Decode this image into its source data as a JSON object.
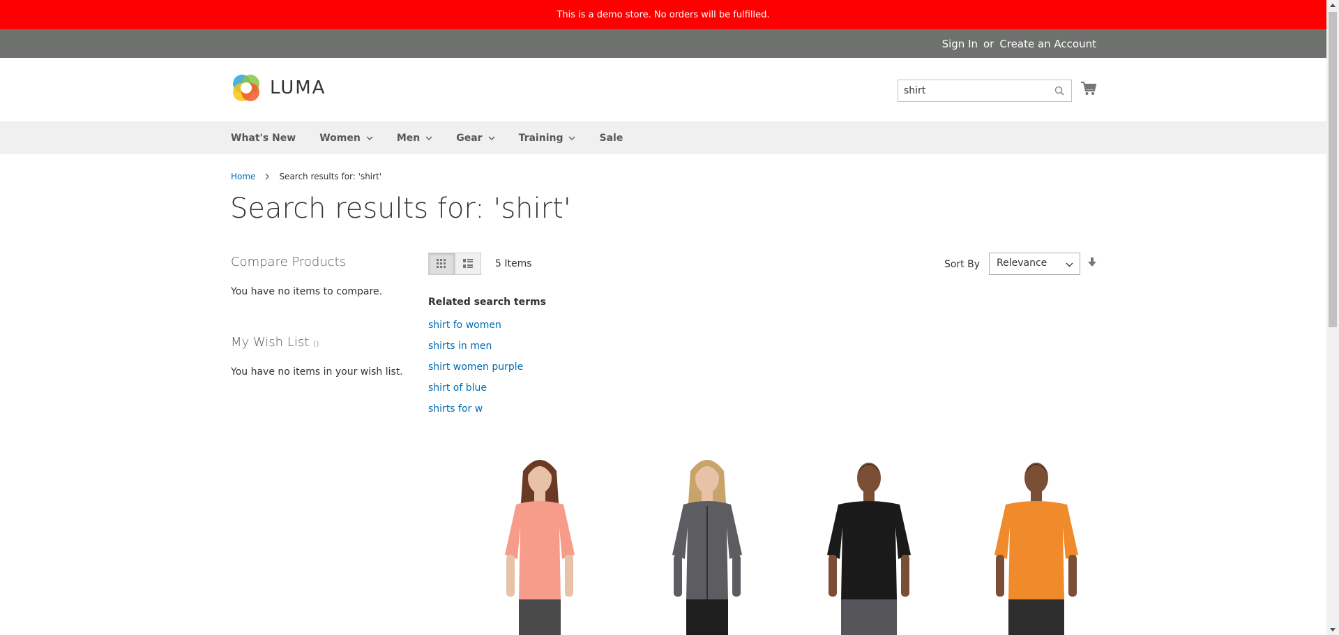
{
  "demo_notice": "This is a demo store. No orders will be fulfilled.",
  "top_links": {
    "sign_in": "Sign In",
    "or": "or",
    "create_account": "Create an Account"
  },
  "header": {
    "logo_text": "LUMA",
    "search_value": "shirt",
    "icons": [
      "search-icon",
      "cart-icon"
    ]
  },
  "nav": {
    "items": [
      {
        "label": "What's New",
        "has_dropdown": false
      },
      {
        "label": "Women",
        "has_dropdown": true
      },
      {
        "label": "Men",
        "has_dropdown": true
      },
      {
        "label": "Gear",
        "has_dropdown": true
      },
      {
        "label": "Training",
        "has_dropdown": true
      },
      {
        "label": "Sale",
        "has_dropdown": false
      }
    ]
  },
  "breadcrumb": {
    "home": "Home",
    "current": "Search results for: 'shirt'"
  },
  "page_title": "Search results for: 'shirt'",
  "sidebar": {
    "compare_title": "Compare Products",
    "compare_text": "You have no items to compare.",
    "wishlist_title": "My Wish List",
    "wishlist_count": "()",
    "wishlist_text": "You have no items in your wish list."
  },
  "toolbar": {
    "items_count": "5 Items",
    "sort_label": "Sort By",
    "sort_value": "Relevance",
    "modes": [
      "grid-view",
      "list-view"
    ]
  },
  "related": {
    "title": "Related search terms",
    "terms": [
      "shirt fo women",
      "shirts in men",
      "shirt women purple",
      "shirt of blue",
      "shirts for w"
    ]
  },
  "products": [
    {
      "name": "woman-pink-tee",
      "shirt_color": "#f79c8a",
      "pants_color": "#4a4a4a"
    },
    {
      "name": "woman-gray-hoodie",
      "shirt_color": "#5c5c61",
      "pants_color": "#1e1e1e"
    },
    {
      "name": "man-black-tee",
      "shirt_color": "#1a1a1a",
      "pants_color": "#56565a"
    },
    {
      "name": "man-orange-tee",
      "shirt_color": "#f08b2b",
      "pants_color": "#2d2d2d"
    }
  ],
  "colors": {
    "demo_bar": "#ff0000",
    "top_bar": "#6e716e",
    "link": "#006bb4",
    "nav_bg": "#f0f0f0"
  }
}
